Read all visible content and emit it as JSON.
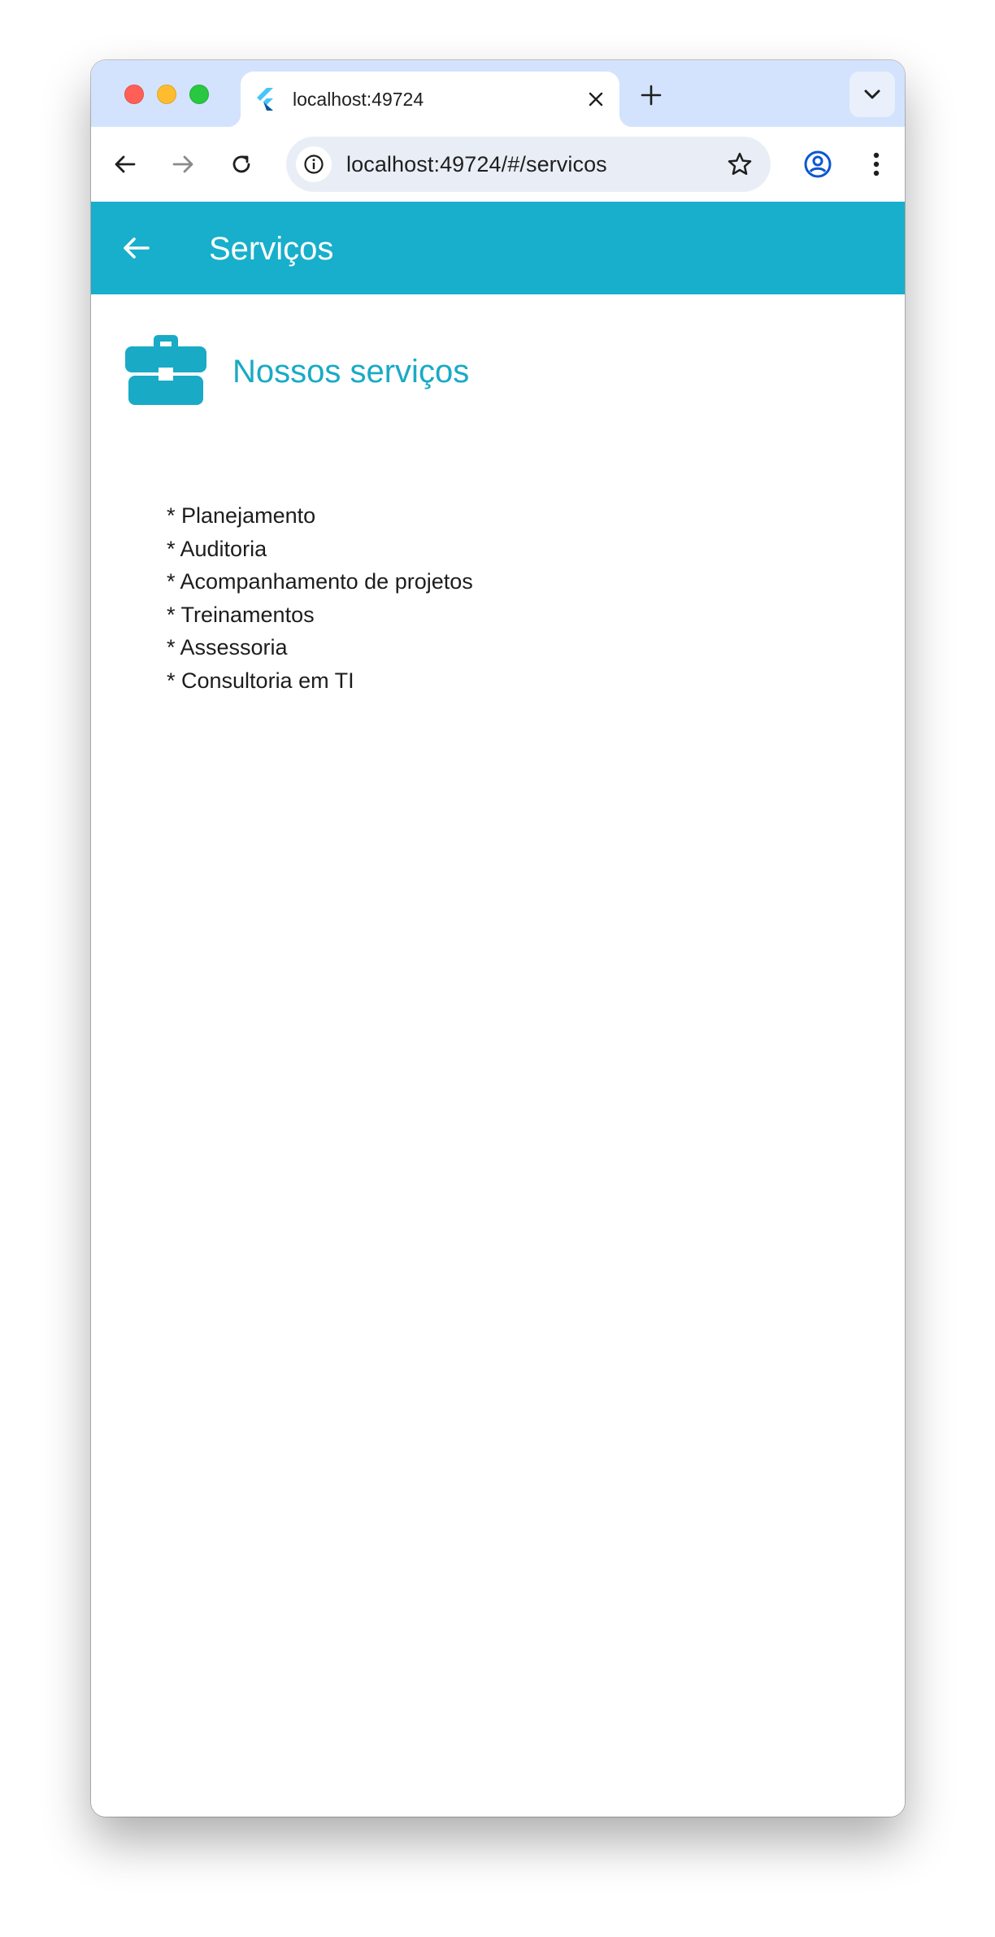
{
  "browser": {
    "tab": {
      "title": "localhost:49724",
      "favicon": "flutter-icon",
      "close_icon": "close-icon"
    },
    "new_tab_icon": "plus-icon",
    "tab_search_icon": "chevron-down-icon",
    "toolbar": {
      "back_icon": "arrow-left-icon",
      "forward_icon": "arrow-right-icon",
      "reload_icon": "reload-icon",
      "site_info_icon": "info-icon",
      "url": "localhost:49724/#/servicos",
      "bookmark_icon": "star-icon",
      "profile_icon": "profile-icon",
      "menu_icon": "more-vertical-icon"
    }
  },
  "app": {
    "appbar": {
      "title": "Serviços",
      "back_icon": "arrow-left-icon",
      "color": "#17afcb"
    },
    "section": {
      "icon": "briefcase-icon",
      "title": "Nossos serviços",
      "accent_color": "#19aac6"
    },
    "services": [
      "* Planejamento",
      "* Auditoria",
      "* Acompanhamento de projetos",
      "* Treinamentos",
      "* Assessoria",
      "* Consultoria em TI"
    ]
  }
}
